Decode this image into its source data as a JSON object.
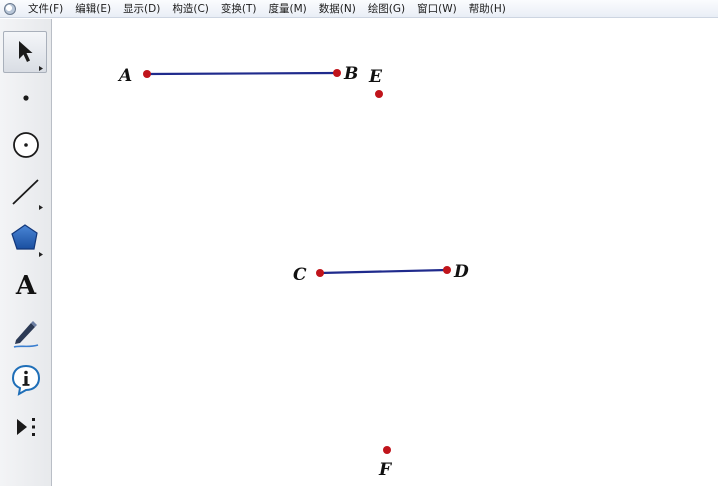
{
  "menu": {
    "items": [
      {
        "id": "file",
        "label": "文件(F)"
      },
      {
        "id": "edit",
        "label": "编辑(E)"
      },
      {
        "id": "display",
        "label": "显示(D)"
      },
      {
        "id": "construct",
        "label": "构造(C)"
      },
      {
        "id": "transform",
        "label": "变换(T)"
      },
      {
        "id": "measure",
        "label": "度量(M)"
      },
      {
        "id": "data",
        "label": "数据(N)"
      },
      {
        "id": "graph",
        "label": "绘图(G)"
      },
      {
        "id": "window",
        "label": "窗口(W)"
      },
      {
        "id": "help",
        "label": "帮助(H)"
      }
    ]
  },
  "toolbox": {
    "tools": [
      {
        "id": "selection-arrow",
        "icon": "arrow-cursor-icon",
        "active": true
      },
      {
        "id": "point",
        "icon": "point-icon",
        "active": false
      },
      {
        "id": "compass",
        "icon": "circle-icon",
        "active": false
      },
      {
        "id": "straightedge",
        "icon": "line-icon",
        "active": false
      },
      {
        "id": "polygon",
        "icon": "polygon-icon",
        "active": false
      },
      {
        "id": "text",
        "icon": "text-icon",
        "label": "A",
        "active": false
      },
      {
        "id": "marker",
        "icon": "pen-icon",
        "active": false
      },
      {
        "id": "information",
        "icon": "info-icon",
        "active": false
      },
      {
        "id": "custom",
        "icon": "custom-tool-icon",
        "active": false
      }
    ]
  },
  "sketch": {
    "segment_color": "#1f2a8c",
    "point_color": "#c0141b",
    "points": {
      "A": {
        "label": "A"
      },
      "B": {
        "label": "B"
      },
      "C": {
        "label": "C"
      },
      "D": {
        "label": "D"
      },
      "E": {
        "label": "E"
      },
      "F": {
        "label": "F"
      }
    },
    "segments": [
      {
        "from": "A",
        "to": "B"
      },
      {
        "from": "C",
        "to": "D"
      }
    ]
  }
}
